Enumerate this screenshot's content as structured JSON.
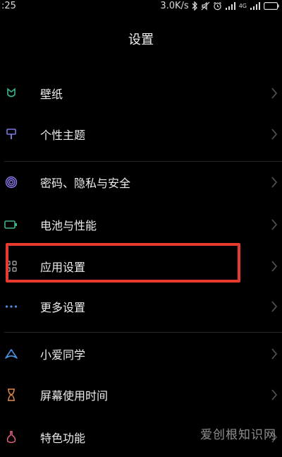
{
  "status_bar": {
    "time": ":25",
    "net_speed": "3.0K/s",
    "network_type": "4G"
  },
  "header": {
    "title": "设置"
  },
  "settings": {
    "items": [
      {
        "label": "壁纸",
        "icon": "wallpaper-icon"
      },
      {
        "label": "个性主题",
        "icon": "theme-brush-icon"
      },
      {
        "label": "密码、隐私与安全",
        "icon": "fingerprint-icon"
      },
      {
        "label": "电池与性能",
        "icon": "battery-icon"
      },
      {
        "label": "应用设置",
        "icon": "apps-grid-icon"
      },
      {
        "label": "更多设置",
        "icon": "more-dots-icon"
      },
      {
        "label": "小爱同学",
        "icon": "xiaoai-icon"
      },
      {
        "label": "屏幕使用时间",
        "icon": "hourglass-icon"
      },
      {
        "label": "特色功能",
        "icon": "flask-icon"
      }
    ]
  },
  "watermark": "爱创根知识网",
  "colors": {
    "background": "#000000",
    "highlight_border": "#e63a2e",
    "wallpaper_icon": "#3fb38a",
    "theme_icon": "#7b78e0",
    "privacy_icon": "#8a7cf0",
    "battery_icon": "#3fb38a",
    "apps_icon": "#9a9a9a",
    "more_icon": "#4a90e2",
    "xiaoai_icon": "#4a90e2",
    "hourglass_icon": "#e08a4a",
    "flask_icon": "#e0607a"
  }
}
